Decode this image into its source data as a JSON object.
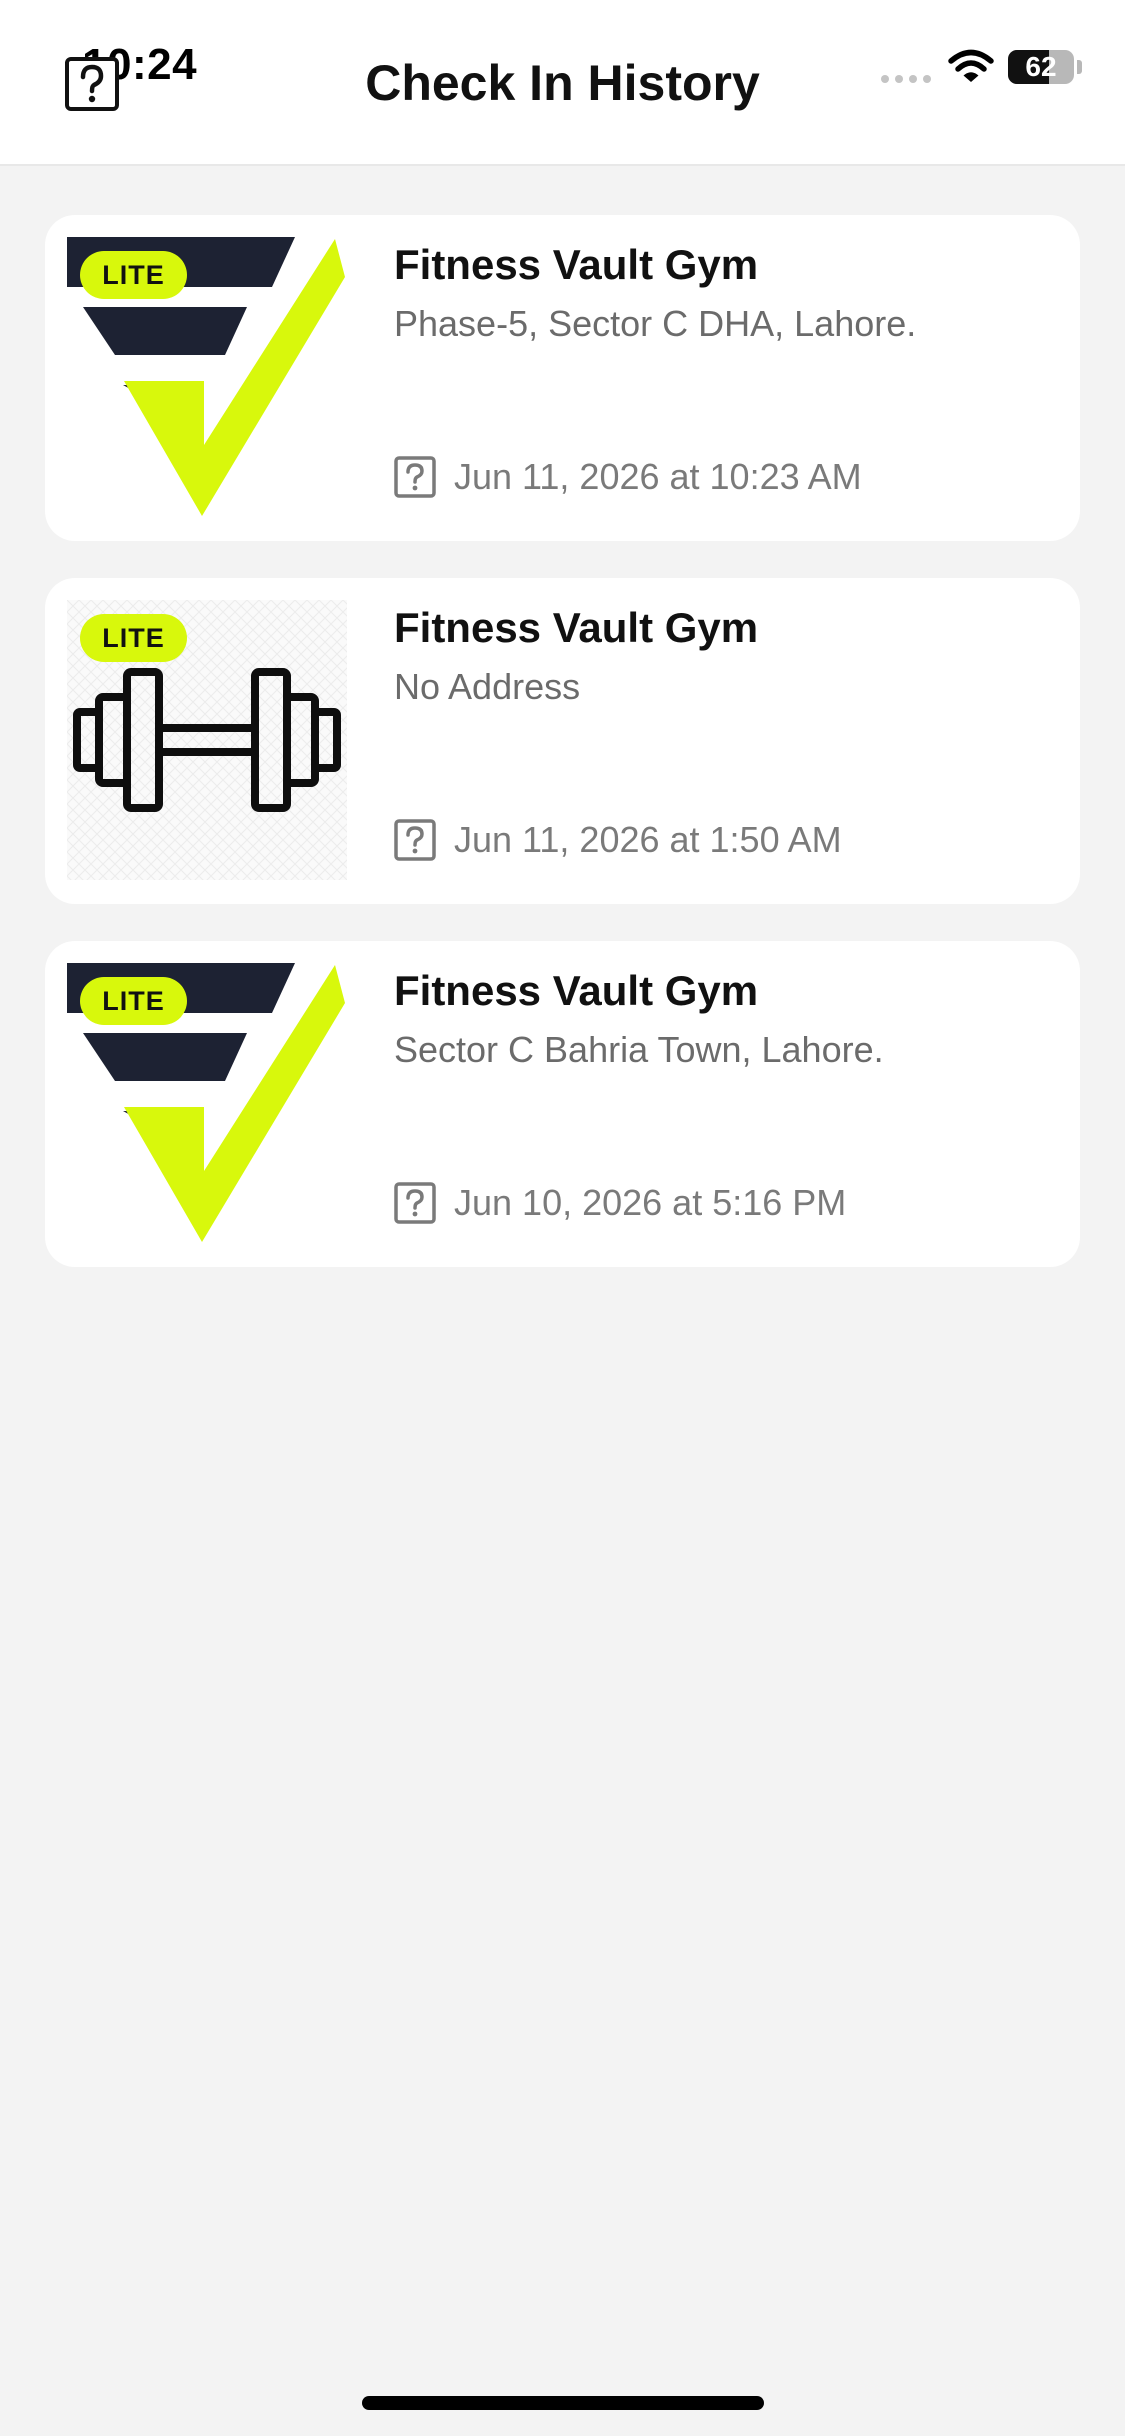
{
  "status_bar": {
    "time": "10:24",
    "battery": "62",
    "battery_level": 0.62
  },
  "header": {
    "title": "Check In History"
  },
  "colors": {
    "accent": "#d8f80c",
    "logo_navy": "#1d2233",
    "background": "#f3f3f3",
    "card": "#ffffff"
  },
  "checkins": [
    {
      "badge": "LITE",
      "thumbnail": "fitness-vault-logo",
      "name": "Fitness Vault Gym",
      "address": "Phase-5, Sector C DHA, Lahore.",
      "time": "Jun 11, 2026 at 10:23 AM"
    },
    {
      "badge": "LITE",
      "thumbnail": "dumbbell-icon",
      "name": "Fitness Vault Gym",
      "address": "No Address",
      "time": "Jun 11, 2026 at 1:50 AM"
    },
    {
      "badge": "LITE",
      "thumbnail": "fitness-vault-logo",
      "name": "Fitness Vault Gym",
      "address": "Sector C Bahria Town, Lahore.",
      "time": "Jun 10, 2026 at 5:16 PM"
    }
  ]
}
